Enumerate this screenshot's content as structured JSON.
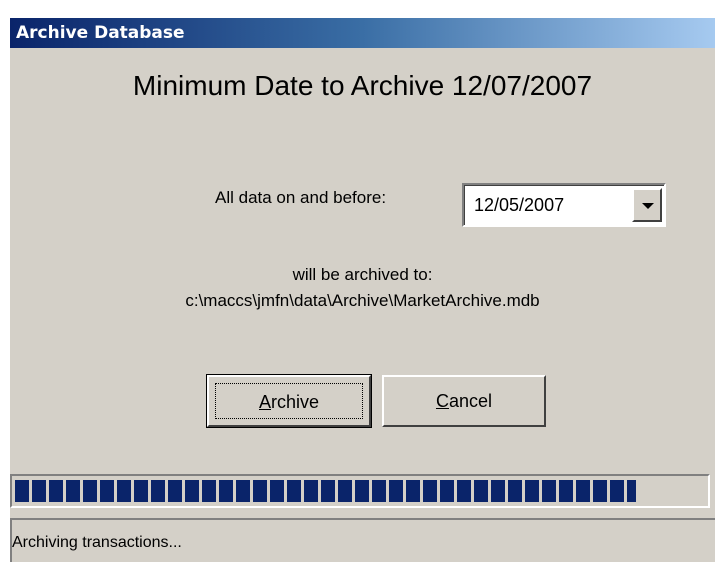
{
  "window": {
    "title": "Archive Database"
  },
  "main": {
    "heading": "Minimum Date to Archive 12/07/2007",
    "before_label": "All data on and before:",
    "date_select": {
      "value": "12/05/2007"
    },
    "archived_to_line1": "will be archived to:",
    "archived_to_path": "c:\\maccs\\jmfn\\data\\Archive\\MarketArchive.mdb"
  },
  "buttons": {
    "archive": {
      "accel": "A",
      "rest": "rchive"
    },
    "cancel": {
      "accel": "C",
      "rest": "ancel"
    }
  },
  "progress": {
    "percent": 90
  },
  "status": {
    "text": "Archiving transactions..."
  },
  "colors": {
    "title_start": "#0a246a",
    "title_end": "#a6caf0",
    "progress_fill": "#0a246a",
    "face": "#d4d0c8"
  }
}
